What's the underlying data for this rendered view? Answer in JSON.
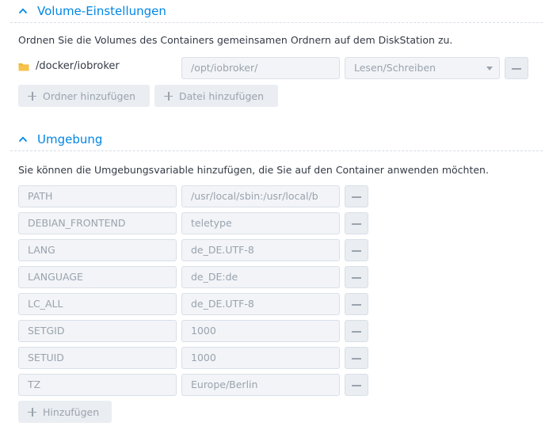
{
  "volume_section": {
    "title": "Volume-Einstellungen",
    "description": "Ordnen Sie die Volumes des Containers gemeinsamen Ordnern auf dem DiskStation zu.",
    "mapping": {
      "folder": "/docker/iobroker",
      "mount_path": "/opt/iobroker/",
      "permission": "Lesen/Schreiben"
    },
    "add_folder_label": "Ordner hinzufügen",
    "add_file_label": "Datei hinzufügen"
  },
  "env_section": {
    "title": "Umgebung",
    "description": "Sie können die Umgebungsvariable hinzufügen, die Sie auf den Container anwenden möchten.",
    "variables": [
      {
        "name": "PATH",
        "value": "/usr/local/sbin:/usr/local/b"
      },
      {
        "name": "DEBIAN_FRONTEND",
        "value": "teletype"
      },
      {
        "name": "LANG",
        "value": "de_DE.UTF-8"
      },
      {
        "name": "LANGUAGE",
        "value": "de_DE:de"
      },
      {
        "name": "LC_ALL",
        "value": "de_DE.UTF-8"
      },
      {
        "name": "SETGID",
        "value": "1000"
      },
      {
        "name": "SETUID",
        "value": "1000"
      },
      {
        "name": "TZ",
        "value": "Europe/Berlin"
      }
    ],
    "add_label": "Hinzufügen"
  },
  "colors": {
    "accent": "#0086e5",
    "folder": "#f5b52e",
    "disabled_text": "#9aa3ae"
  },
  "icons": {
    "collapse": "chevron-up-icon",
    "folder": "folder-icon",
    "remove": "minus-icon",
    "add": "plus-icon"
  }
}
